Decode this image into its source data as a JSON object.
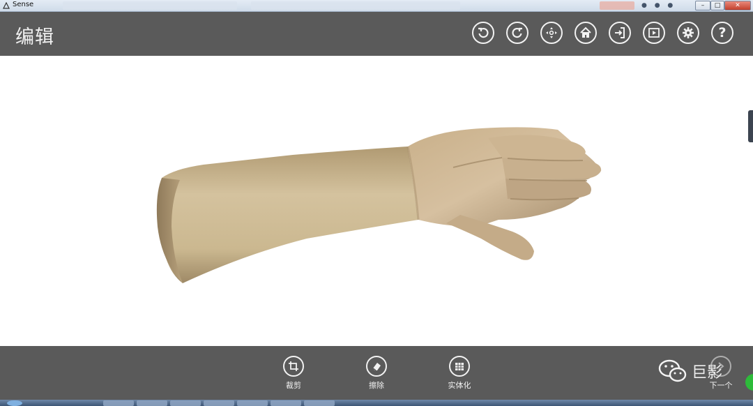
{
  "window": {
    "title": "Sense",
    "controls": {
      "minimize": "–",
      "maximize": "□",
      "close": "✕"
    }
  },
  "header": {
    "title": "编辑",
    "tools": [
      {
        "name": "undo-icon"
      },
      {
        "name": "redo-icon"
      },
      {
        "name": "move-icon"
      },
      {
        "name": "home-icon"
      },
      {
        "name": "export-icon"
      },
      {
        "name": "play-icon"
      },
      {
        "name": "gear-icon"
      },
      {
        "name": "help-icon",
        "glyph": "?"
      }
    ]
  },
  "viewport": {
    "model": "scanned-hand-3d-model",
    "colors": {
      "skin_light": "#d8c6a4",
      "skin_mid": "#c2ac86",
      "skin_dark": "#8f7a5a",
      "background": "#ffffff"
    }
  },
  "bottom": {
    "tools": [
      {
        "icon": "crop-icon",
        "label": "裁剪"
      },
      {
        "icon": "eraser-icon",
        "label": "擦除"
      },
      {
        "icon": "solidify-icon",
        "label": "实体化"
      }
    ],
    "watermark": "巨影",
    "next_label": "下一个"
  },
  "colors": {
    "bar_bg": "#5a5a5a",
    "icon_stroke": "#f2f2f2",
    "accent_green": "#2dbb3a"
  }
}
